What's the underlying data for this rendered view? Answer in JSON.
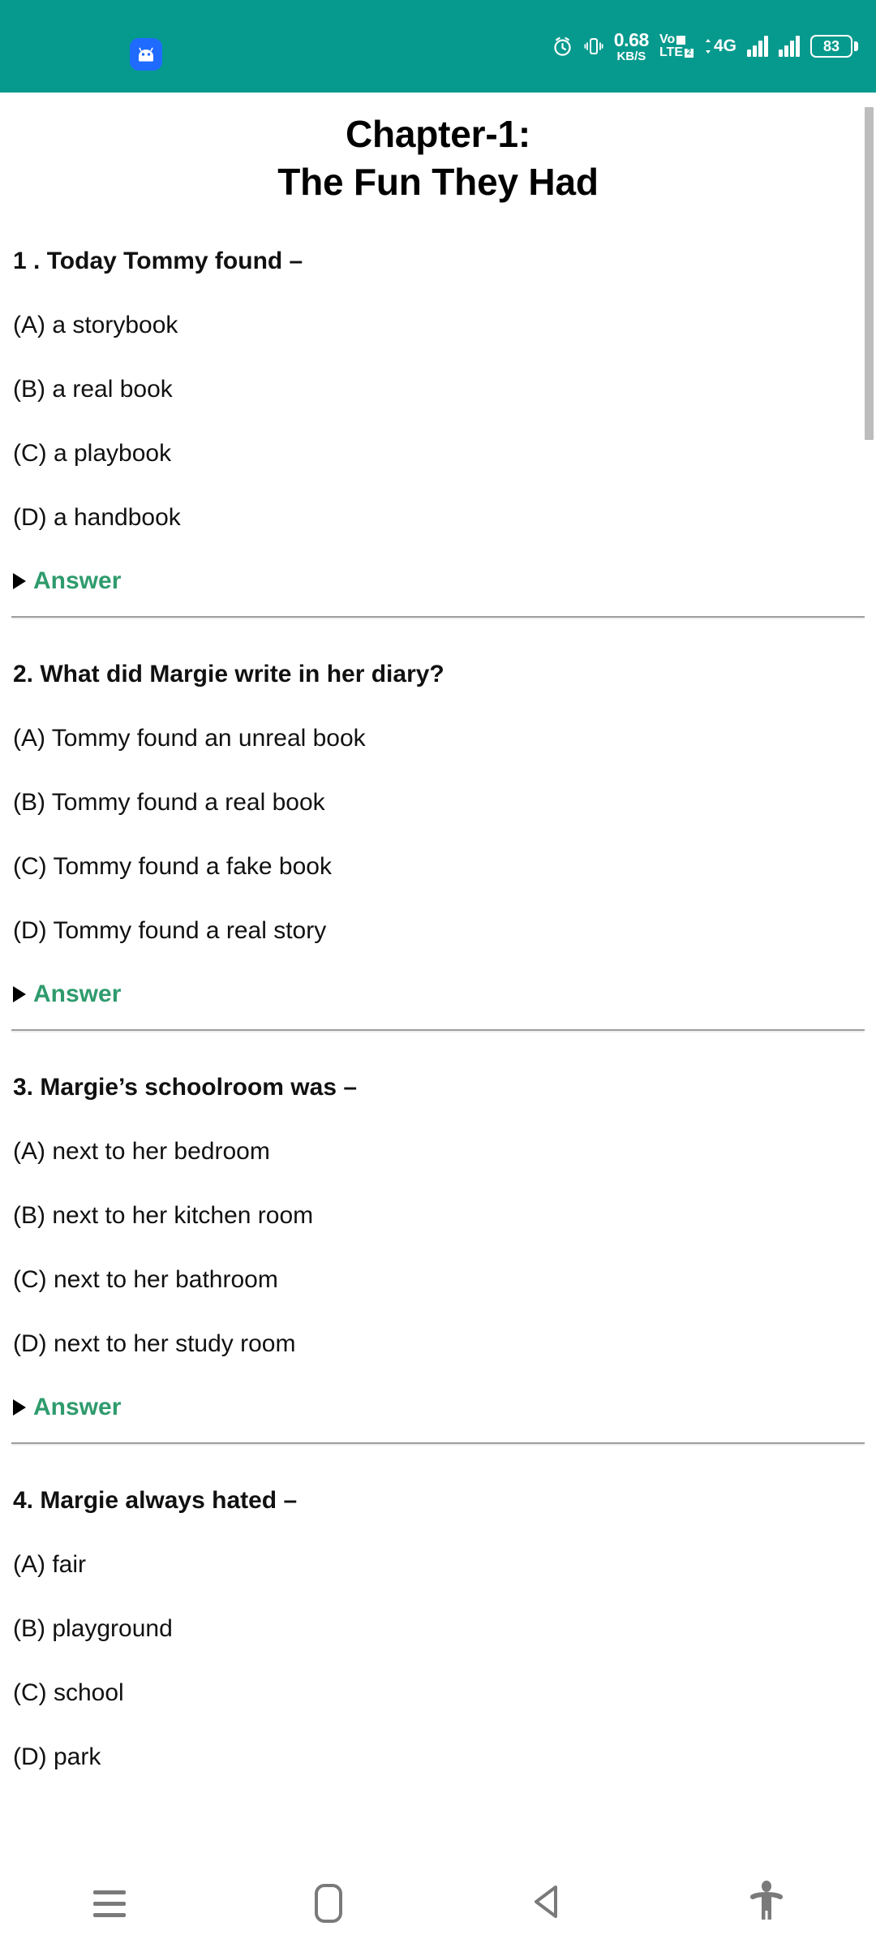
{
  "statusbar": {
    "app_icon": "android-robot-icon",
    "alarm_icon": "alarm-clock-icon",
    "vibrate_icon": "vibrate-icon",
    "network_speed": {
      "value": "0.68",
      "unit": "KB/S"
    },
    "volte": {
      "line1": "Vo",
      "line2": "LTE",
      "sim_badge_1": "1",
      "sim_badge_2": "2"
    },
    "network_type": "4G",
    "signal_icon_1": "signal-bars-icon",
    "signal_icon_2": "signal-bars-icon",
    "battery": {
      "level": "83"
    }
  },
  "page": {
    "title_line1": "Chapter-1:",
    "title_line2": "The Fun They Had",
    "answer_label": "Answer",
    "questions": [
      {
        "number": "1 .",
        "text": "1 . Today Tommy found –",
        "options": [
          "(A) a storybook",
          "(B) a real book",
          "(C) a playbook",
          "(D) a handbook"
        ]
      },
      {
        "number": "2.",
        "text": "2. What did Margie write in her diary?",
        "options": [
          "(A) Tommy found an unreal book",
          "(B) Tommy found a real book",
          "(C) Tommy found a fake book",
          "(D) Tommy found a real story"
        ]
      },
      {
        "number": "3.",
        "text": "3. Margie’s schoolroom was –",
        "options": [
          "(A) next to her bedroom",
          "(B) next to her kitchen room",
          "(C) next to her bathroom",
          "(D) next to her study room"
        ]
      },
      {
        "number": "4.",
        "text": "4. Margie always hated –",
        "options": [
          "(A) fair",
          "(B) playground",
          "(C) school",
          "(D) park"
        ]
      }
    ]
  },
  "navbar": {
    "items": [
      {
        "name": "recents-icon"
      },
      {
        "name": "home-icon"
      },
      {
        "name": "back-icon"
      },
      {
        "name": "accessibility-icon"
      }
    ]
  },
  "colors": {
    "status_bar_bg": "#069a8e",
    "answer_green": "#2f9b6d",
    "android_badge_blue": "#1f6bff",
    "nav_icon_gray": "#7a7a7a",
    "scrollbar_thumb": "#bdbdbd"
  }
}
